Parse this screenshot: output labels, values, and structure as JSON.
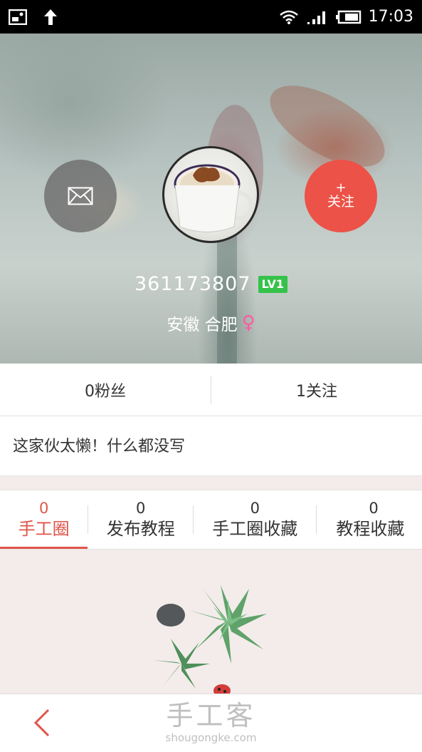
{
  "status_bar": {
    "time": "17:03",
    "icons": [
      "image-icon",
      "upload-arrow-icon",
      "wifi-icon",
      "signal-icon",
      "battery-icon"
    ]
  },
  "profile": {
    "username": "361173807",
    "level": "LV1",
    "location": "安徽 合肥",
    "gender_symbol": "♀",
    "follow_plus": "+",
    "follow_label": "关注"
  },
  "stats": {
    "fans": "0粉丝",
    "following": "1关注"
  },
  "bio": "这家伙太懒！什么都没写",
  "tabs": [
    {
      "count": "0",
      "label": "手工圈",
      "active": true
    },
    {
      "count": "0",
      "label": "发布教程",
      "active": false
    },
    {
      "count": "0",
      "label": "手工圈收藏",
      "active": false
    },
    {
      "count": "0",
      "label": "教程收藏",
      "active": false
    }
  ],
  "watermark": {
    "title": "手工客",
    "url": "shougongke.com"
  },
  "colors": {
    "accent": "#e15449",
    "follow_button": "#ec5247",
    "level_badge": "#35c24a",
    "gender": "#ff5aa0"
  }
}
